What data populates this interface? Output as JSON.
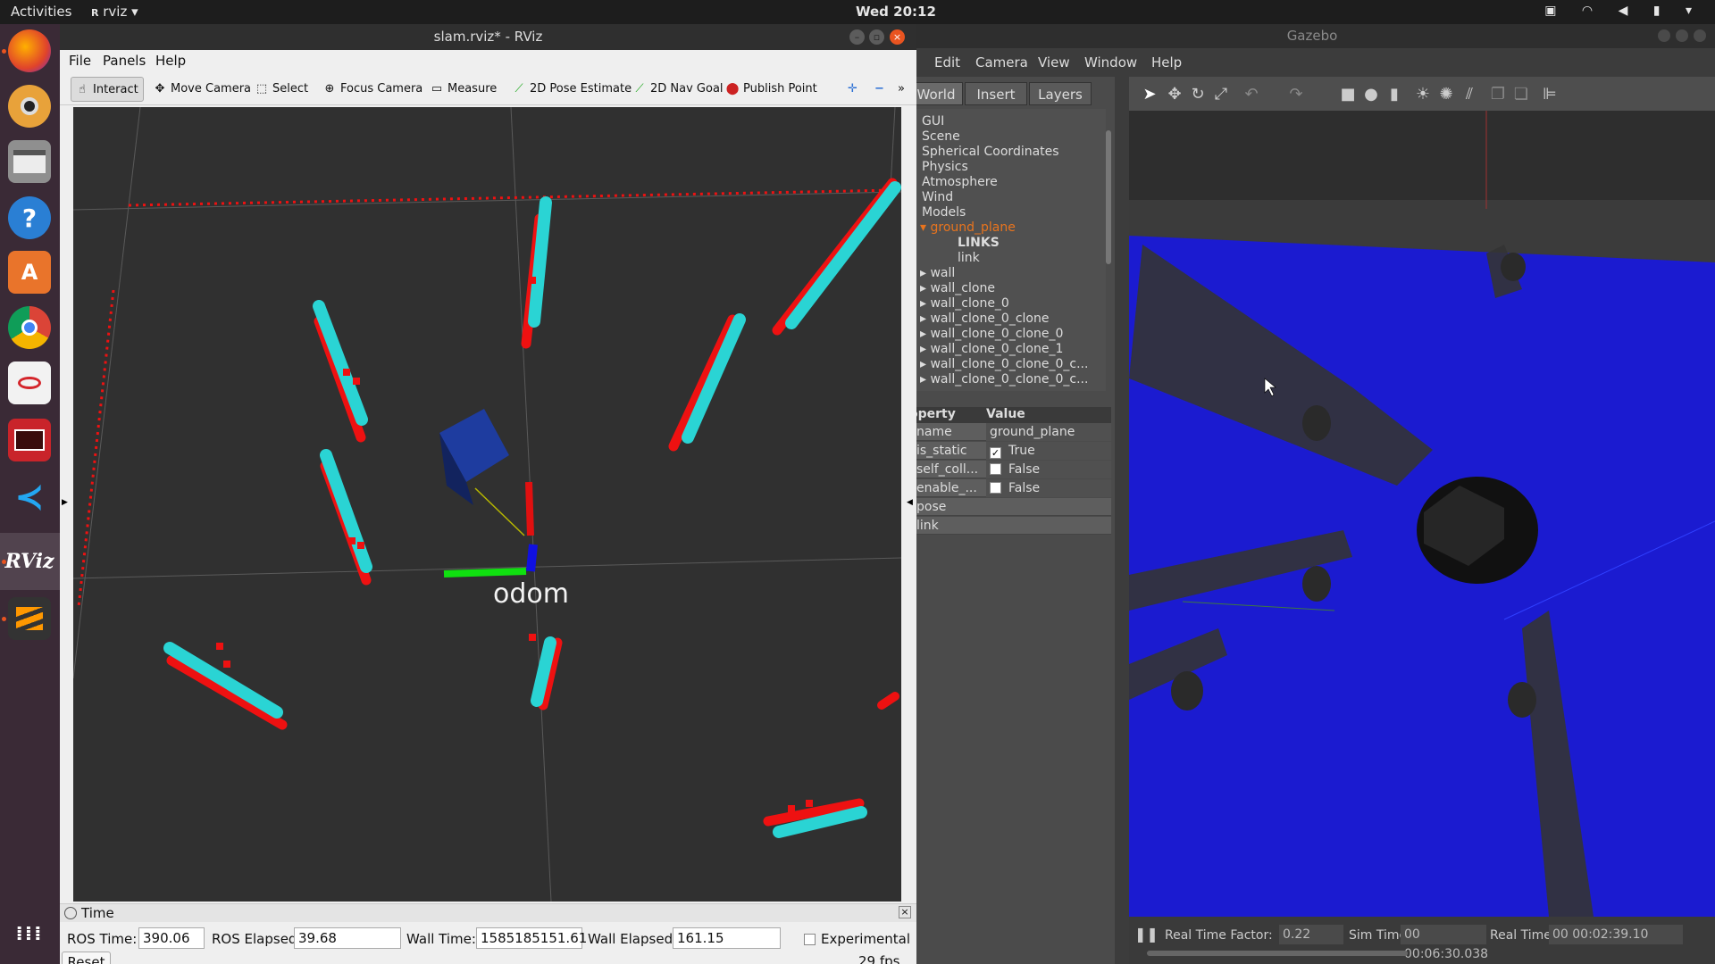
{
  "topbar": {
    "activities": "Activities",
    "app_menu": "rviz",
    "clock": "Wed 20:12"
  },
  "dock": {
    "apps": [
      "firefox-icon",
      "rhythmbox-icon",
      "files-icon",
      "help-icon",
      "software-icon",
      "chrome-icon",
      "writer-icon",
      "terminal-icon",
      "vscode-icon",
      "rviz-icon",
      "sublime-icon"
    ],
    "rviz_label": "RViz",
    "show_apps_icon": "grid-icon"
  },
  "rviz": {
    "title": "slam.rviz* - RViz",
    "menu": {
      "file": "File",
      "panels": "Panels",
      "help": "Help"
    },
    "tools": {
      "interact": "Interact",
      "move_camera": "Move Camera",
      "select": "Select",
      "focus_camera": "Focus Camera",
      "measure": "Measure",
      "pose_estimate": "2D Pose Estimate",
      "nav_goal": "2D Nav Goal",
      "publish_point": "Publish Point"
    },
    "viewport": {
      "frame_label": "odom"
    },
    "time_panel": {
      "title": "Time",
      "ros_time_label": "ROS Time:",
      "ros_time": "390.06",
      "ros_elapsed_label": "ROS Elapsed:",
      "ros_elapsed": "39.68",
      "wall_time_label": "Wall Time:",
      "wall_time": "1585185151.61",
      "wall_elapsed_label": "Wall Elapsed:",
      "wall_elapsed": "161.15",
      "experimental": "Experimental",
      "reset": "Reset",
      "fps": "29 fps"
    }
  },
  "gazebo": {
    "title": "Gazebo",
    "menu": {
      "edit": "Edit",
      "camera": "Camera",
      "view": "View",
      "window": "Window",
      "help": "Help"
    },
    "tabs": {
      "world": "World",
      "insert": "Insert",
      "layers": "Layers"
    },
    "tree": {
      "gui": "GUI",
      "scene": "Scene",
      "spherical": "Spherical Coordinates",
      "physics": "Physics",
      "atmosphere": "Atmosphere",
      "wind": "Wind",
      "models": "Models",
      "ground_plane": "ground_plane",
      "links": "LINKS",
      "link": "link",
      "wall": "wall",
      "wall_clone": "wall_clone",
      "wall_clone_0": "wall_clone_0",
      "wall_clone_0_clone": "wall_clone_0_clone",
      "wall_clone_0_clone_0": "wall_clone_0_clone_0",
      "wall_clone_0_clone_1": "wall_clone_0_clone_1",
      "wall_c1": "wall_clone_0_clone_0_c...",
      "wall_c2": "wall_clone_0_clone_0_c..."
    },
    "props": {
      "header_property": "operty",
      "header_value": "Value",
      "name_key": "name",
      "name_val": "ground_plane",
      "is_static_key": "is_static",
      "is_static_val": "True",
      "self_coll_key": "self_coll...",
      "self_coll_val": "False",
      "enable_key": "enable_...",
      "enable_val": "False",
      "pose": "pose",
      "link": "link"
    },
    "status": {
      "rtf_label": "Real Time Factor:",
      "rtf": "0.22",
      "sim_label": "Sim Time:",
      "sim": "00 00:06:30.038",
      "real_label": "Real Time:",
      "real": "00 00:02:39.10"
    }
  }
}
